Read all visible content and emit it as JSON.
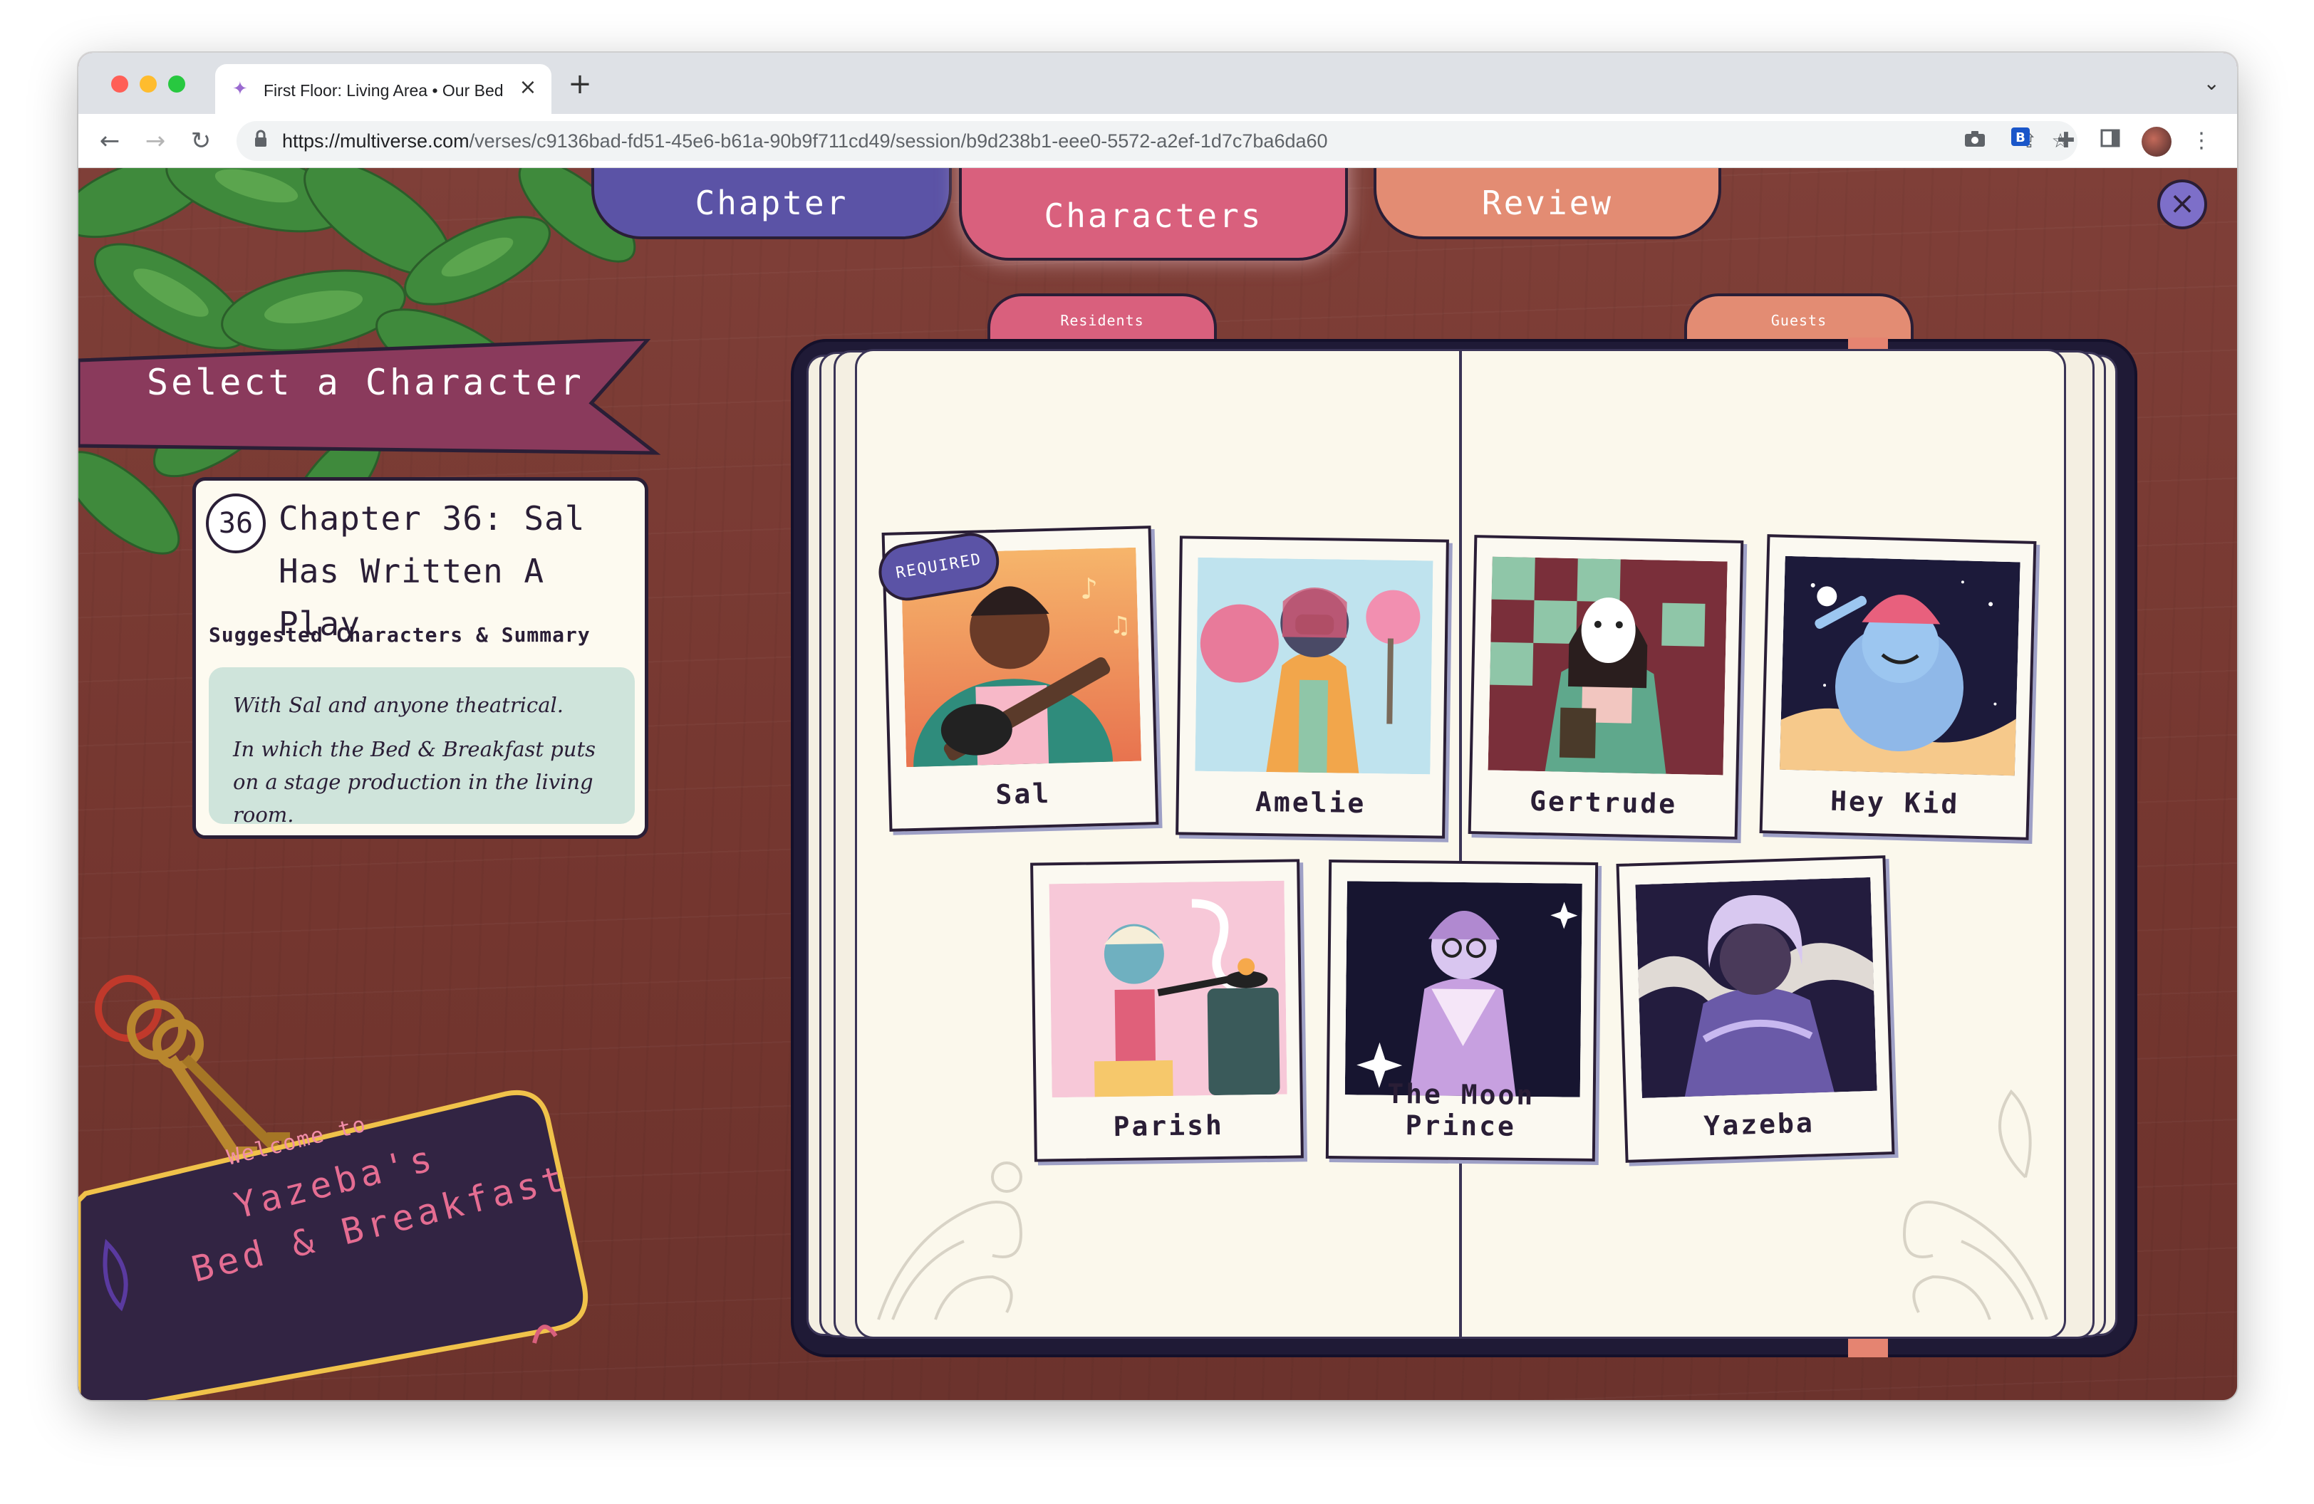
{
  "browser": {
    "tab_title": "First Floor: Living Area • Our Bed & Breakfast",
    "url_host": "https://multiverse.com",
    "url_path": "/verses/c9136bad-fd51-45e6-b61a-90b9f711cd49/session/b9d238b1-eee0-5572-a2ef-1d7c7ba6da60",
    "icons": {
      "favicon": "multiverse-logo-icon",
      "close_tab": "close-icon",
      "new_tab": "plus-icon",
      "back": "arrow-left-icon",
      "forward": "arrow-right-icon",
      "reload": "reload-icon",
      "lock": "lock-icon",
      "share": "share-icon",
      "bookmark": "star-icon",
      "camera": "camera-icon",
      "extension": "extension-icon",
      "puzzle": "puzzle-icon",
      "sidebar": "sidebar-icon",
      "menu": "kebab-menu-icon"
    }
  },
  "nav": {
    "chapter_label": "Chapter",
    "characters_label": "Characters",
    "review_label": "Review",
    "active": "Characters"
  },
  "header": {
    "select_label": "Select a Character"
  },
  "chapter": {
    "number": "36",
    "title": "Chapter 36: Sal Has Written A Play",
    "suggested_label": "Suggested Characters & Summary",
    "summary_line1": "With Sal and anyone theatrical.",
    "summary_line2": "In which the Bed & Breakfast puts on a stage production in the living room."
  },
  "book": {
    "tabs": {
      "residents": "Residents",
      "guests": "Guests"
    },
    "characters": [
      {
        "name": "Sal",
        "required": true,
        "badge": "REQUIRED"
      },
      {
        "name": "Amelie"
      },
      {
        "name": "Gertrude"
      },
      {
        "name": "Hey Kid"
      },
      {
        "name": "Parish"
      },
      {
        "name": "The Moon Prince"
      },
      {
        "name": "Yazeba"
      }
    ]
  },
  "sign": {
    "welcome": "Welcome to",
    "name": "Yazeba's",
    "place": "Bed & Breakfast"
  },
  "colors": {
    "wood": "#7a3a34",
    "chapter_tab": "#5b53a6",
    "characters_tab": "#d9607d",
    "review_tab": "#e38c73",
    "banner": "#8a3a5c",
    "summary_bg": "#cfe4db",
    "page": "#fbf8ec",
    "ink": "#2a1e36"
  }
}
